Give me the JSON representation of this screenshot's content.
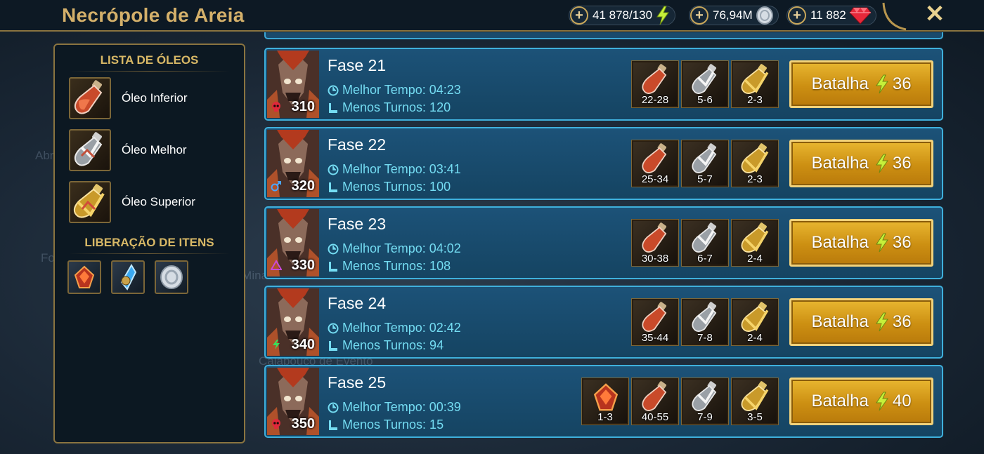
{
  "header": {
    "title": "Necrópole de Areia",
    "resources": [
      {
        "value": "41 878/130",
        "icon": "energy-bolt-icon"
      },
      {
        "value": "76,94M",
        "icon": "silver-coin-icon"
      },
      {
        "value": "11 882",
        "icon": "gem-icon"
      }
    ],
    "plus_symbol": "+",
    "close_symbol": "✕"
  },
  "background_labels": [
    "Abr",
    "Fo",
    "o Mina",
    "Calabouço de Evento"
  ],
  "sidebar": {
    "oils_heading": "LISTA DE ÓLEOS",
    "oils": [
      {
        "label": "Óleo Inferior",
        "icon": "lesser-oil-icon"
      },
      {
        "label": "Óleo Melhor",
        "icon": "greater-oil-icon"
      },
      {
        "label": "Óleo Superior",
        "icon": "superior-oil-icon"
      }
    ],
    "drops_heading": "LIBERAÇÃO DE ITENS",
    "drops": [
      "gem-artifact-icon",
      "blue-shard-icon",
      "silver-coin-icon"
    ]
  },
  "stages": [
    {
      "name": "Fase 21",
      "level": "310",
      "affinity": "skull",
      "best_time": "Melhor Tempo: 04:23",
      "min_turns": "Menos Turnos: 120",
      "rewards": [
        "22-28",
        "5-6",
        "2-3"
      ],
      "battle_label": "Batalha",
      "energy": "36"
    },
    {
      "name": "Fase 22",
      "level": "320",
      "affinity": "magic",
      "best_time": "Melhor Tempo: 03:41",
      "min_turns": "Menos Turnos: 100",
      "rewards": [
        "25-34",
        "5-7",
        "2-3"
      ],
      "battle_label": "Batalha",
      "energy": "36"
    },
    {
      "name": "Fase 23",
      "level": "330",
      "affinity": "void",
      "best_time": "Melhor Tempo: 04:02",
      "min_turns": "Menos Turnos: 108",
      "rewards": [
        "30-38",
        "6-7",
        "2-4"
      ],
      "battle_label": "Batalha",
      "energy": "36"
    },
    {
      "name": "Fase 24",
      "level": "340",
      "affinity": "force",
      "best_time": "Melhor Tempo: 02:42",
      "min_turns": "Menos Turnos: 94",
      "rewards": [
        "35-44",
        "7-8",
        "2-4"
      ],
      "battle_label": "Batalha",
      "energy": "36"
    },
    {
      "name": "Fase 25",
      "level": "350",
      "affinity": "skull",
      "best_time": "Melhor Tempo: 00:39",
      "min_turns": "Menos Turnos: 15",
      "extra_reward": "1-3",
      "rewards": [
        "40-55",
        "7-9",
        "3-5"
      ],
      "battle_label": "Batalha",
      "energy": "40"
    }
  ],
  "colors": {
    "gold": "#d4b06a",
    "stage_border": "#3fb0dc",
    "stat_text": "#74dcf2",
    "battle_button": "#e8b630"
  }
}
